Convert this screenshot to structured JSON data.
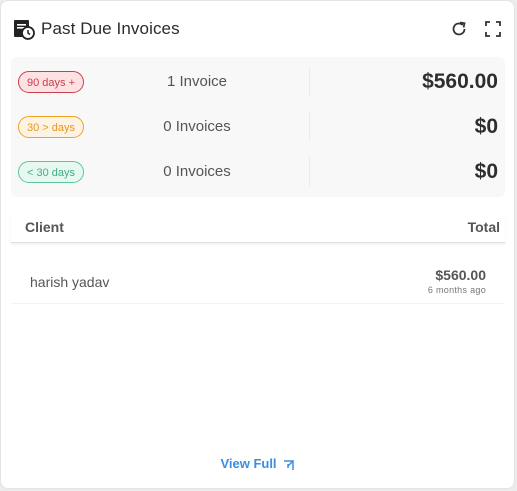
{
  "widget": {
    "title": "Past Due Invoices",
    "icons": {
      "title": "invoice-clock-icon",
      "refresh": "refresh-icon",
      "fullscreen": "fullscreen-icon"
    }
  },
  "summary": [
    {
      "badge": "90 days +",
      "badge_color": "#c9404f",
      "count": "1 Invoice",
      "amount": "$560.00"
    },
    {
      "badge": "30 > days",
      "badge_color": "#f2a224",
      "count": "0 Invoices",
      "amount": "$0"
    },
    {
      "badge": "< 30 days",
      "badge_color": "#59c79a",
      "count": "0 Invoices",
      "amount": "$0"
    }
  ],
  "table": {
    "headers": {
      "client": "Client",
      "total": "Total"
    },
    "rows": [
      {
        "client": "harish yadav",
        "total": "$560.00",
        "ago": "6 months ago"
      }
    ]
  },
  "footer": {
    "view_full_label": "View Full",
    "icon": "external-corner-arrow-icon",
    "link_color": "#3a8ee6"
  }
}
